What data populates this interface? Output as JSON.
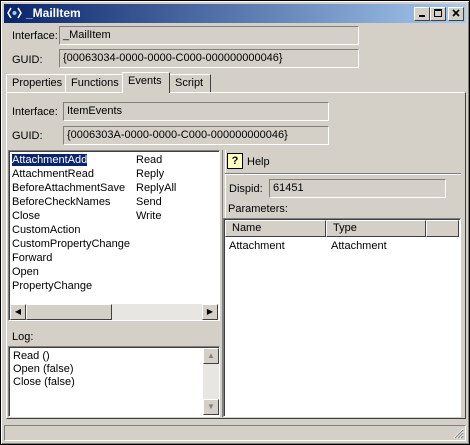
{
  "window": {
    "title": "_MailItem"
  },
  "header": {
    "interface_label": "Interface:",
    "interface_value": "_MailItem",
    "guid_label": "GUID:",
    "guid_value": "{00063034-0000-0000-C000-000000000046}"
  },
  "tabs": [
    {
      "label": "Properties"
    },
    {
      "label": "Functions"
    },
    {
      "label": "Events",
      "active": true
    },
    {
      "label": "Script"
    }
  ],
  "events_tab": {
    "interface_label": "Interface:",
    "interface_value": "ItemEvents",
    "guid_label": "GUID:",
    "guid_value": "{0006303A-0000-0000-C000-000000000046}",
    "events_col1": [
      "AttachmentAdd",
      "AttachmentRead",
      "BeforeAttachmentSave",
      "BeforeCheckNames",
      "Close",
      "CustomAction",
      "CustomPropertyChange",
      "Forward",
      "Open",
      "PropertyChange"
    ],
    "events_col2": [
      "Read",
      "Reply",
      "ReplyAll",
      "Send",
      "Write"
    ],
    "selected_event": "AttachmentAdd",
    "help_label": "Help",
    "dispid_label": "Dispid:",
    "dispid_value": "61451",
    "parameters_label": "Parameters:",
    "param_columns": [
      "Name",
      "Type"
    ],
    "params": [
      {
        "name": "Attachment",
        "type": "Attachment"
      }
    ],
    "log_label": "Log:",
    "log_lines": [
      "Read ()",
      "Open (false)",
      "Close (false)"
    ]
  }
}
